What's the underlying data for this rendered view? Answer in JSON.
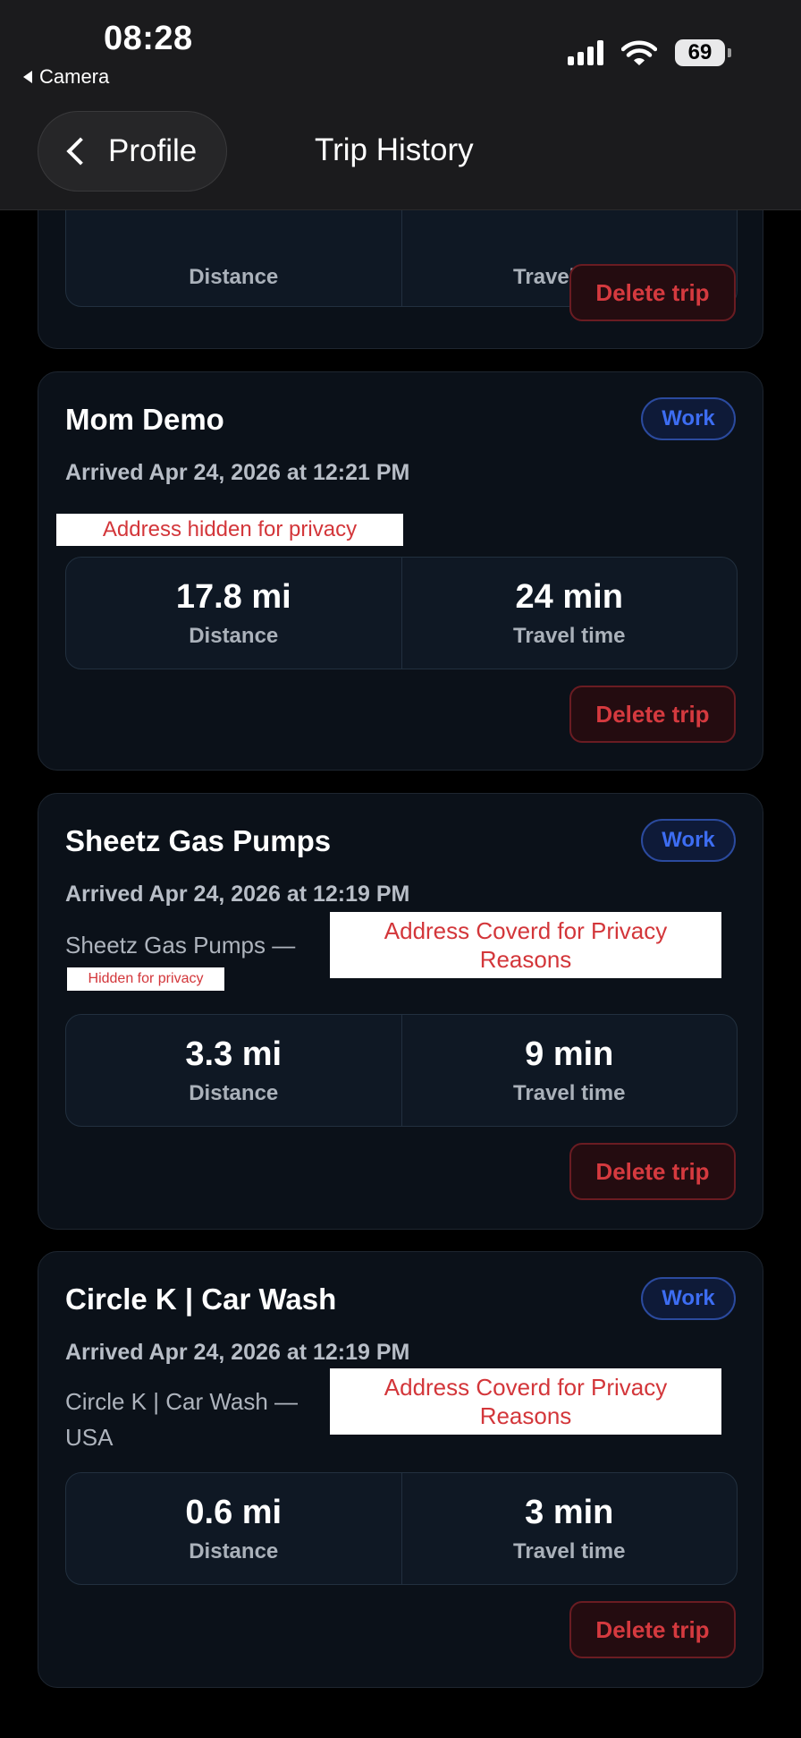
{
  "status_bar": {
    "time": "08:28",
    "back_app": "Camera",
    "battery": "69"
  },
  "nav": {
    "back_label": "Profile",
    "title": "Trip History"
  },
  "partial_card": {
    "distance_label": "Distance",
    "travel_label": "Travel time",
    "delete_label": "Delete trip"
  },
  "trips": [
    {
      "title": "Mom Demo",
      "tag": "Work",
      "arrived": "Arrived Apr 24, 2026 at 12:21 PM",
      "privacy_note": "Address hidden for privacy",
      "distance": "17.8 mi",
      "distance_label": "Distance",
      "travel_time": "24 min",
      "travel_label": "Travel time",
      "delete_label": "Delete trip"
    },
    {
      "title": "Sheetz Gas Pumps",
      "tag": "Work",
      "arrived": "Arrived Apr 24, 2026 at 12:19 PM",
      "address_start": "Sheetz Gas Pumps —",
      "privacy_note": "Address Coverd for Privacy Reasons",
      "privacy_note_small": "Hidden for privacy",
      "distance": "3.3 mi",
      "distance_label": "Distance",
      "travel_time": "9 min",
      "travel_label": "Travel time",
      "delete_label": "Delete trip"
    },
    {
      "title": "Circle K | Car Wash",
      "tag": "Work",
      "arrived": "Arrived Apr 24, 2026 at 12:19 PM",
      "address_start": "Circle K | Car Wash —",
      "address_end": "USA",
      "privacy_note": "Address Coverd for Privacy Reasons",
      "distance": "0.6 mi",
      "distance_label": "Distance",
      "travel_time": "3 min",
      "travel_label": "Travel time",
      "delete_label": "Delete trip"
    }
  ]
}
